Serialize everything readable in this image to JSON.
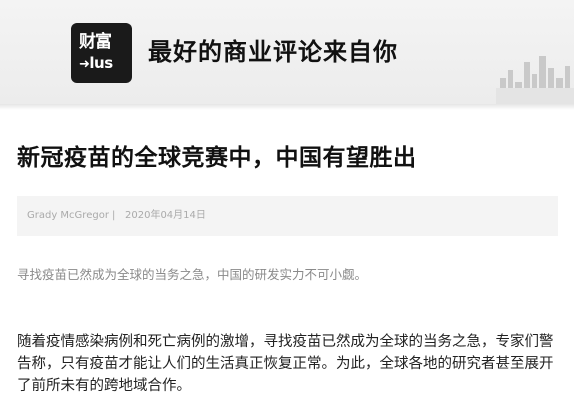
{
  "header": {
    "logo_line1": "财富",
    "logo_line2_arrow": "➜",
    "logo_line2": "lus",
    "slogan": "最好的商业评论来自你"
  },
  "article": {
    "title": "新冠疫苗的全球竞赛中，中国有望胜出",
    "author": "Grady McGregor",
    "separator": "|",
    "date": "2020年04月14日",
    "summary": "寻找疫苗已然成为全球的当务之急，中国的研发实力不可小觑。",
    "body_lines": [
      "随着疫情感染病例和死亡病例的激增，寻找疫苗已然成为全球的当务之急，专家们警",
      "告称，只有疫苗才能让人们的生活真正恢复正常。为此，全球各地的研究者甚至展开",
      "了前所未有的跨地域合作。"
    ]
  }
}
